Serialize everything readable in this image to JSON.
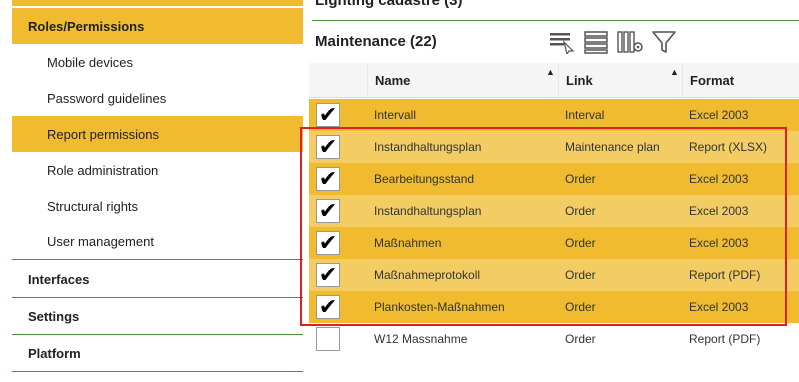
{
  "sidebar": {
    "items": [
      {
        "label": "Roles/Permissions"
      },
      {
        "label": "Mobile devices"
      },
      {
        "label": "Password guidelines"
      },
      {
        "label": "Report permissions"
      },
      {
        "label": "Role administration"
      },
      {
        "label": "Structural rights"
      },
      {
        "label": "User management"
      },
      {
        "label": "Interfaces"
      },
      {
        "label": "Settings"
      },
      {
        "label": "Platform"
      }
    ]
  },
  "main": {
    "section_title": "Lighting cadastre (3)",
    "panel_title": "Maintenance (22)",
    "toolbar": [
      "filter-select-icon",
      "list-view-icon",
      "column-settings-icon",
      "funnel-icon"
    ],
    "columns": {
      "name": "Name",
      "link": "Link",
      "format": "Format"
    },
    "rows": [
      {
        "checked": "✔",
        "name": "Intervall",
        "link": "Interval",
        "format": "Excel 2003"
      },
      {
        "checked": "✔",
        "name": "Instandhaltungsplan",
        "link": "Maintenance plan",
        "format": "Report (XLSX)"
      },
      {
        "checked": "✔",
        "name": "Bearbeitungsstand",
        "link": "Order",
        "format": "Excel 2003"
      },
      {
        "checked": "✔",
        "name": "Instandhaltungsplan",
        "link": "Order",
        "format": "Excel 2003"
      },
      {
        "checked": "✔",
        "name": "Maßnahmen",
        "link": "Order",
        "format": "Excel 2003"
      },
      {
        "checked": "✔",
        "name": "Maßnahmeprotokoll",
        "link": "Order",
        "format": "Report (PDF)"
      },
      {
        "checked": "✔",
        "name": "Plankosten-Maßnahmen",
        "link": "Order",
        "format": "Excel 2003"
      },
      {
        "checked": "",
        "name": "W12 Massnahme",
        "link": "Order",
        "format": "Report (PDF)"
      }
    ]
  },
  "colors": {
    "accent": "#f0bb2e",
    "accent_light": "#f3cc64",
    "divider": "#4a8f3a",
    "highlight_box": "#e02020"
  }
}
